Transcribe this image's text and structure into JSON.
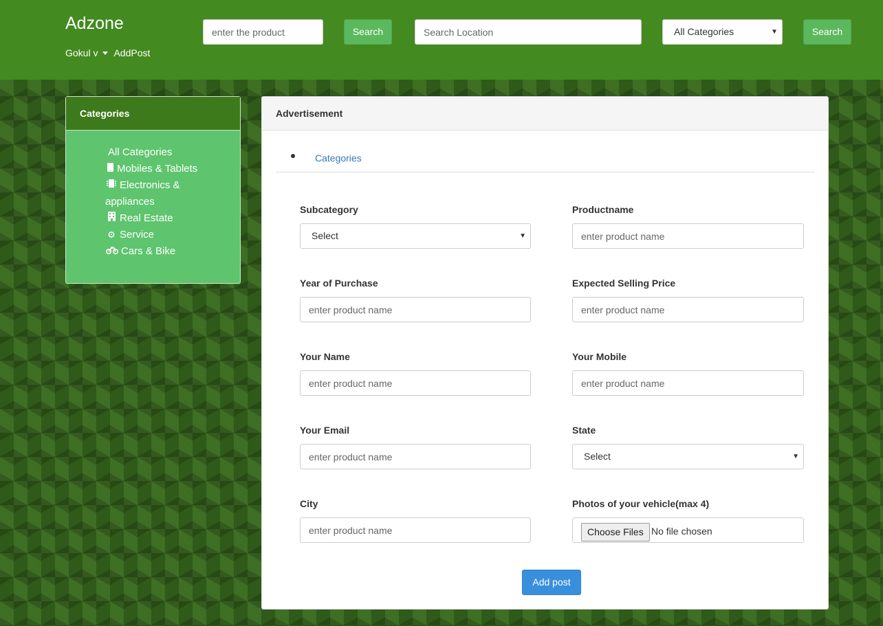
{
  "header": {
    "brand": "Adzone",
    "user_name": "Gokul v",
    "add_post_link": "AddPost",
    "product_search_placeholder": "enter the product",
    "search_button_1": "Search",
    "location_placeholder": "Search Location",
    "category_select": "All Categories",
    "search_button_2": "Search",
    "accent_color": "#438a20"
  },
  "sidebar": {
    "title": "Categories",
    "items": [
      {
        "label": "All Categories",
        "icon": "none"
      },
      {
        "label": "Mobiles & Tablets",
        "icon": "mobile-icon"
      },
      {
        "label": "Electronics & appliances",
        "icon": "chip-icon"
      },
      {
        "label": "Real Estate",
        "icon": "building-icon"
      },
      {
        "label": "Service",
        "icon": "gear-icon"
      },
      {
        "label": "Cars & Bike",
        "icon": "motorcycle-icon"
      }
    ],
    "bg_color": "#5ec46e"
  },
  "panel": {
    "title": "Advertisement",
    "tab": "Categories",
    "fields": {
      "subcategory": {
        "label": "Subcategory",
        "value": "Select"
      },
      "productname": {
        "label": "Productname",
        "placeholder": "enter product name"
      },
      "year": {
        "label": "Year of Purchase",
        "placeholder": "enter product name"
      },
      "price": {
        "label": "Expected Selling Price",
        "placeholder": "enter product name"
      },
      "name": {
        "label": "Your Name",
        "placeholder": "enter product name"
      },
      "mobile": {
        "label": "Your Mobile",
        "placeholder": "enter product name"
      },
      "email": {
        "label": "Your Email",
        "placeholder": "enter product name"
      },
      "state": {
        "label": "State",
        "value": "Select"
      },
      "city": {
        "label": "City",
        "placeholder": "enter product name"
      },
      "photos": {
        "label": "Photos of your vehicle(max 4)",
        "button": "Choose Files",
        "status": "No file chosen"
      }
    },
    "submit": "Add post",
    "submit_color": "#3a8fdd"
  }
}
